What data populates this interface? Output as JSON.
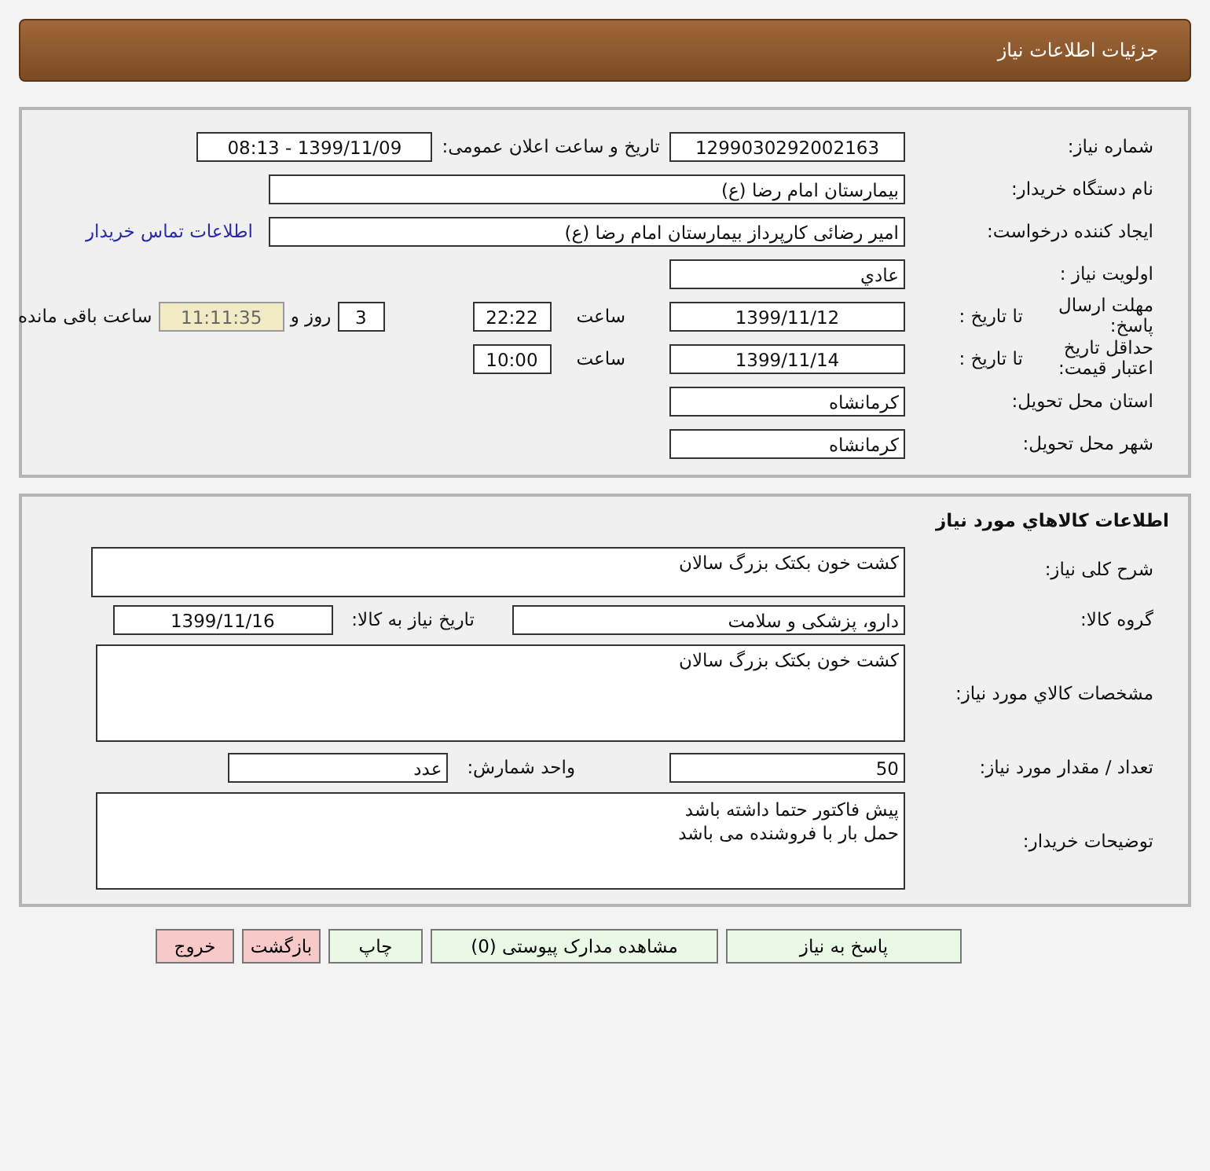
{
  "page_title": "جزئیات اطلاعات نیاز",
  "need_info": {
    "need_number": {
      "label": "شماره نیاز:",
      "value": "1299030292002163"
    },
    "announce": {
      "label": "تاریخ و ساعت اعلان عمومی:",
      "value": "1399/11/09 - 08:13"
    },
    "buyer": {
      "label": "نام دستگاه خریدار:",
      "value": "بیمارستان امام رضا (ع)"
    },
    "creator": {
      "label": "ایجاد کننده درخواست:",
      "value": "امیر رضائی کارپرداز بیمارستان امام رضا (ع)",
      "link": "اطلاعات تماس خریدار"
    },
    "priority": {
      "label": "اولویت نیاز :",
      "value": "عادي"
    },
    "deadline": {
      "label": "مهلت ارسال پاسخ:",
      "to_date_label": "تا تاریخ :",
      "date": "1399/11/12",
      "time_label": "ساعت",
      "time": "22:22",
      "days": "3",
      "days_label": "روز و",
      "remaining": "11:11:35",
      "remaining_label": "ساعت باقی مانده"
    },
    "validity": {
      "label": "حداقل تاریخ اعتبار قیمت:",
      "to_date_label": "تا تاریخ :",
      "date": "1399/11/14",
      "time_label": "ساعت",
      "time": "10:00"
    },
    "province": {
      "label": "استان محل تحویل:",
      "value": "کرمانشاه"
    },
    "city": {
      "label": "شهر محل تحویل:",
      "value": "کرمانشاه"
    }
  },
  "goods": {
    "title": "اطلاعات کالاهاي مورد نیاز",
    "summary": {
      "label": "شرح کلی نیاز:",
      "value": "کشت خون بکتک بزرگ سالان"
    },
    "group": {
      "label": "گروه کالا:",
      "value": "دارو، پزشکی و سلامت",
      "need_date_label": "تاریخ نیاز به کالا:",
      "need_date": "1399/11/16"
    },
    "specs": {
      "label": "مشخصات کالاي مورد نیاز:",
      "value": "کشت خون بکتک بزرگ سالان"
    },
    "quantity": {
      "label": "تعداد / مقدار مورد نیاز:",
      "value": "50",
      "unit_label": "واحد شمارش:",
      "unit": "عدد"
    },
    "notes": {
      "label": "توضیحات خریدار:",
      "lines": [
        "پیش فاکتور حتما داشته باشد",
        "حمل بار با فروشنده می باشد"
      ]
    }
  },
  "buttons": [
    {
      "label": "پاسخ به نیاز",
      "kind": "normal"
    },
    {
      "label": "مشاهده مدارک پیوستی (0)",
      "kind": "normal"
    },
    {
      "label": "چاپ",
      "kind": "normal"
    },
    {
      "label": "بازگشت",
      "kind": "danger"
    },
    {
      "label": "خروج",
      "kind": "danger"
    }
  ]
}
